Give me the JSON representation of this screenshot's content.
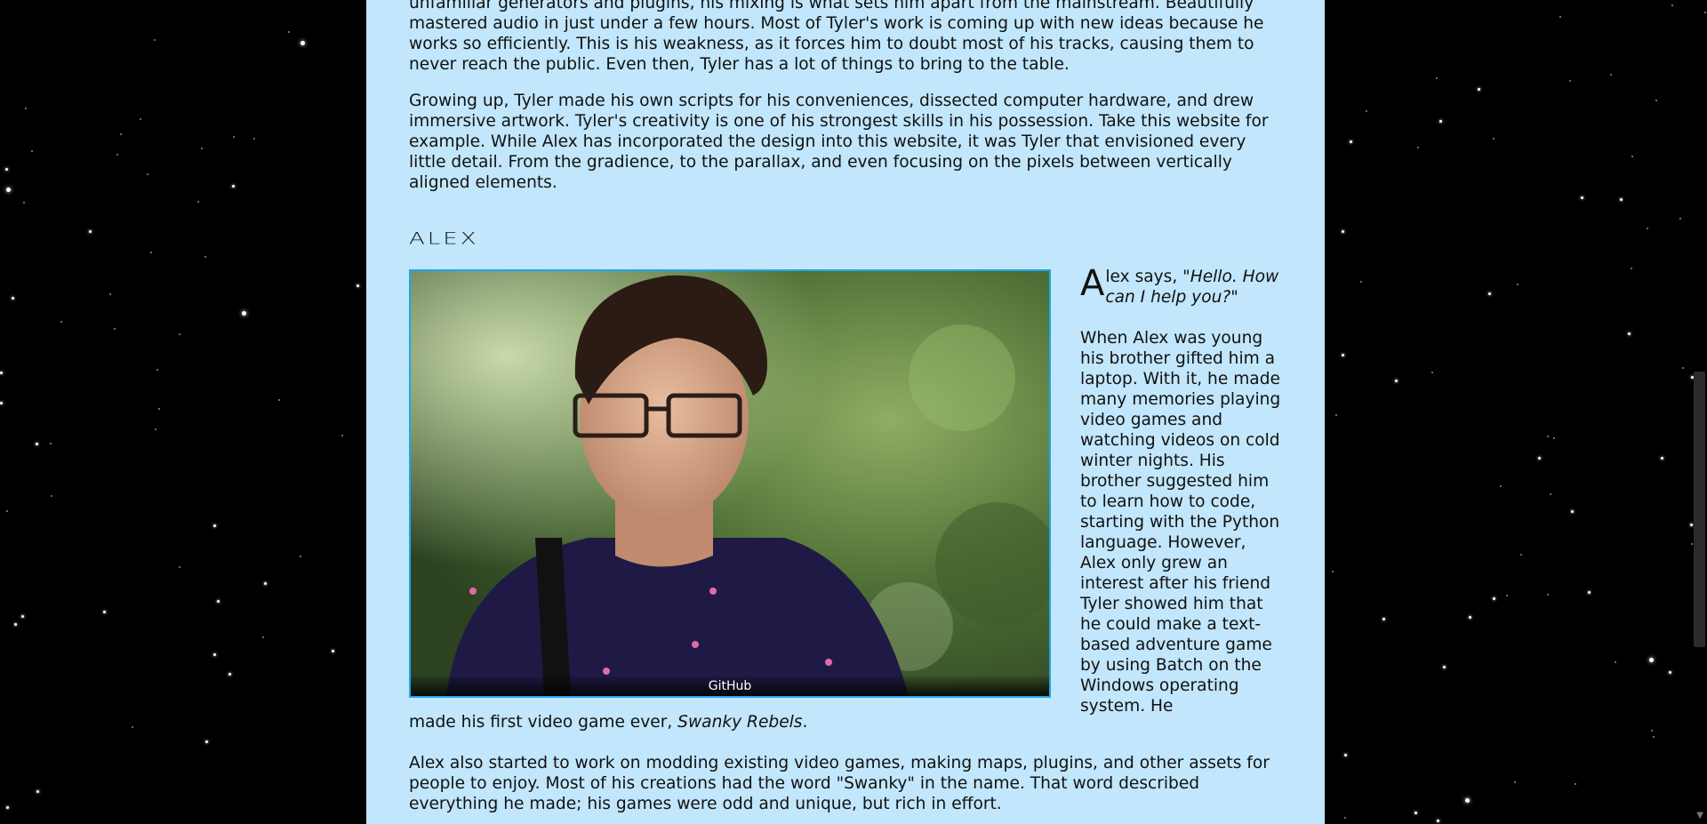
{
  "tyler": {
    "para_top": "unfamiliar generators and plugins, his mixing is what sets him apart from the mainstream. Beautifully mastered audio in just under a few hours. Most of Tyler's work is coming up with new ideas because he works so efficiently. This is his weakness, as it forces him to doubt most of his tracks, causing them to never reach the public. Even then, Tyler has a lot of things to bring to the table.",
    "para_2": "Growing up, Tyler made his own scripts for his conveniences, dissected computer hardware, and drew immersive artwork. Tyler's creativity is one of his strongest skills in his possession. Take this website for example. While Alex has incorporated the design into this website, it was Tyler that envisioned every little detail. From the gradience, to the parallax, and even focusing on the pixels between vertically aligned elements."
  },
  "alex": {
    "title": "ALEX",
    "photo_caption": "GitHub",
    "dropcap": "A",
    "says_prefix": "lex says, ",
    "quote": "\"Hello. How can I help you?\"",
    "story_side": "When Alex was young his brother gifted him a laptop. With it, he made many memories playing video games and watching videos on cold winter nights. His brother suggested him to learn how to code, starting with the Python language. However, Alex only grew an interest after his friend Tyler showed him that he could make a text-based adventure game by using Batch on the Windows operating system. He",
    "story_continued_prefix": "made his first video game ever, ",
    "first_game": "Swanky Rebels",
    "story_continued_suffix": ".",
    "para_last": "Alex also started to work on modding existing video games, making maps, plugins, and other assets for people to enjoy. Most of his creations had the word \"Swanky\" in the name. That word described everything he made; his games were odd and unique, but rich in effort."
  },
  "colors": {
    "panel_bg": "#c2e6fb",
    "photo_border": "#1fa6e8",
    "space_bg": "#000000"
  }
}
